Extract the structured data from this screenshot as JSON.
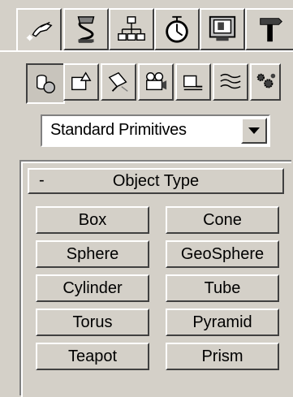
{
  "command_panel": {
    "tabs": [
      {
        "name": "create",
        "icon": "create-tab-icon",
        "active": true
      },
      {
        "name": "modify",
        "icon": "modify-tab-icon"
      },
      {
        "name": "hierarchy",
        "icon": "hierarchy-tab-icon"
      },
      {
        "name": "motion",
        "icon": "motion-tab-icon"
      },
      {
        "name": "display",
        "icon": "display-tab-icon"
      },
      {
        "name": "utilities",
        "icon": "utilities-tab-icon"
      }
    ],
    "categories": [
      {
        "name": "geometry",
        "icon": "geometry-icon",
        "pressed": true
      },
      {
        "name": "shapes",
        "icon": "shapes-icon"
      },
      {
        "name": "lights",
        "icon": "lights-icon"
      },
      {
        "name": "cameras",
        "icon": "cameras-icon"
      },
      {
        "name": "helpers",
        "icon": "helpers-icon"
      },
      {
        "name": "space-warps",
        "icon": "space-warps-icon"
      },
      {
        "name": "systems",
        "icon": "systems-icon"
      }
    ]
  },
  "dropdown": {
    "value": "Standard Primitives"
  },
  "rollout": {
    "toggle": "-",
    "title": "Object Type",
    "buttons": [
      "Box",
      "Cone",
      "Sphere",
      "GeoSphere",
      "Cylinder",
      "Tube",
      "Torus",
      "Pyramid",
      "Teapot",
      "Prism"
    ]
  }
}
